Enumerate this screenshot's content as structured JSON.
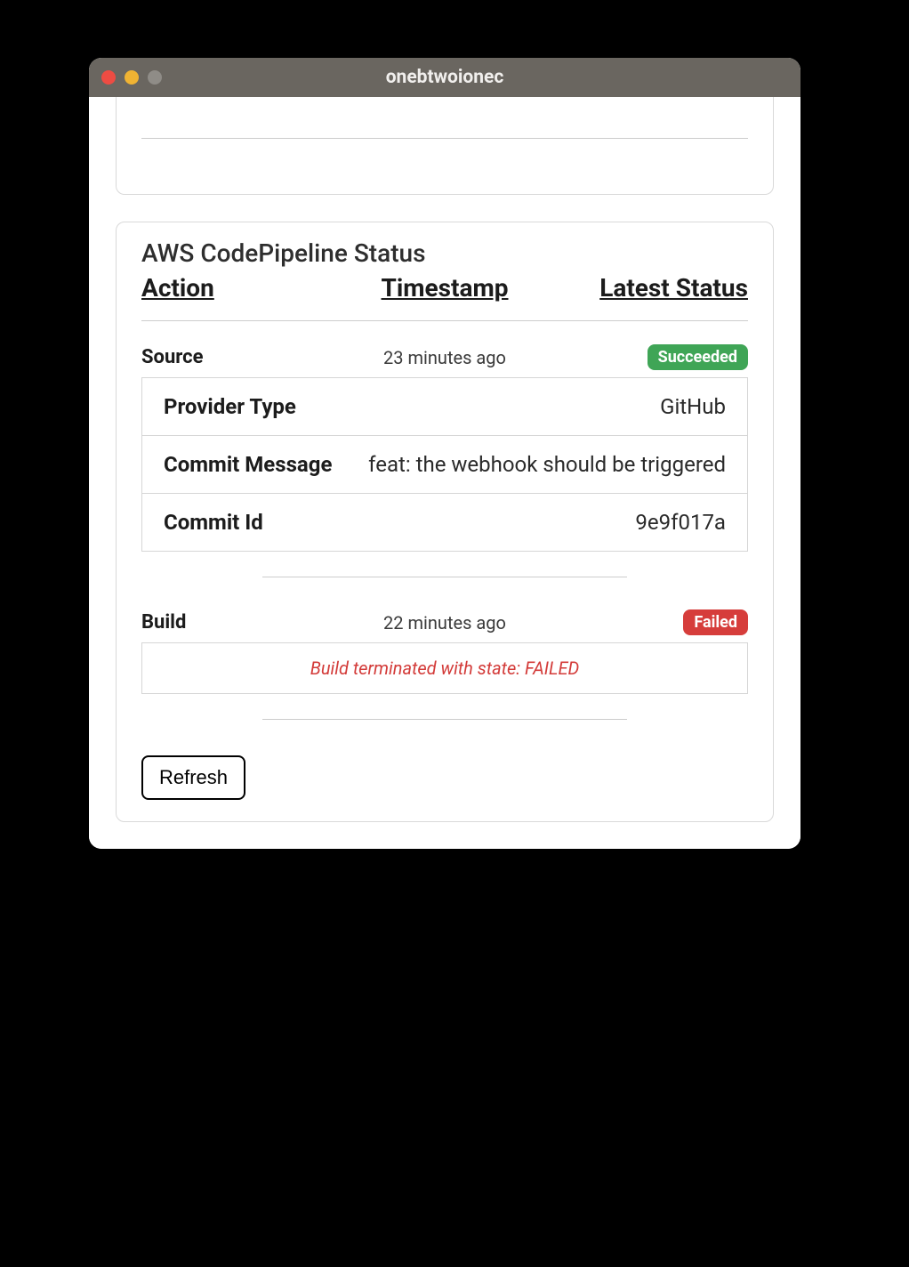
{
  "window": {
    "title": "onebtwoionec"
  },
  "panel": {
    "title": "AWS CodePipeline Status",
    "headers": {
      "action": "Action",
      "timestamp": "Timestamp",
      "status": "Latest Status"
    },
    "stages": [
      {
        "name": "Source",
        "timestamp": "23 minutes ago",
        "status": {
          "text": "Succeeded",
          "variant": "success"
        },
        "details": [
          {
            "label": "Provider Type",
            "value": "GitHub"
          },
          {
            "label": "Commit Message",
            "value": "feat: the webhook should be triggered"
          },
          {
            "label": "Commit Id",
            "value": "9e9f017a"
          }
        ]
      },
      {
        "name": "Build",
        "timestamp": "22 minutes ago",
        "status": {
          "text": "Failed",
          "variant": "failed"
        },
        "error": "Build terminated with state: FAILED"
      }
    ],
    "refresh_label": "Refresh"
  }
}
